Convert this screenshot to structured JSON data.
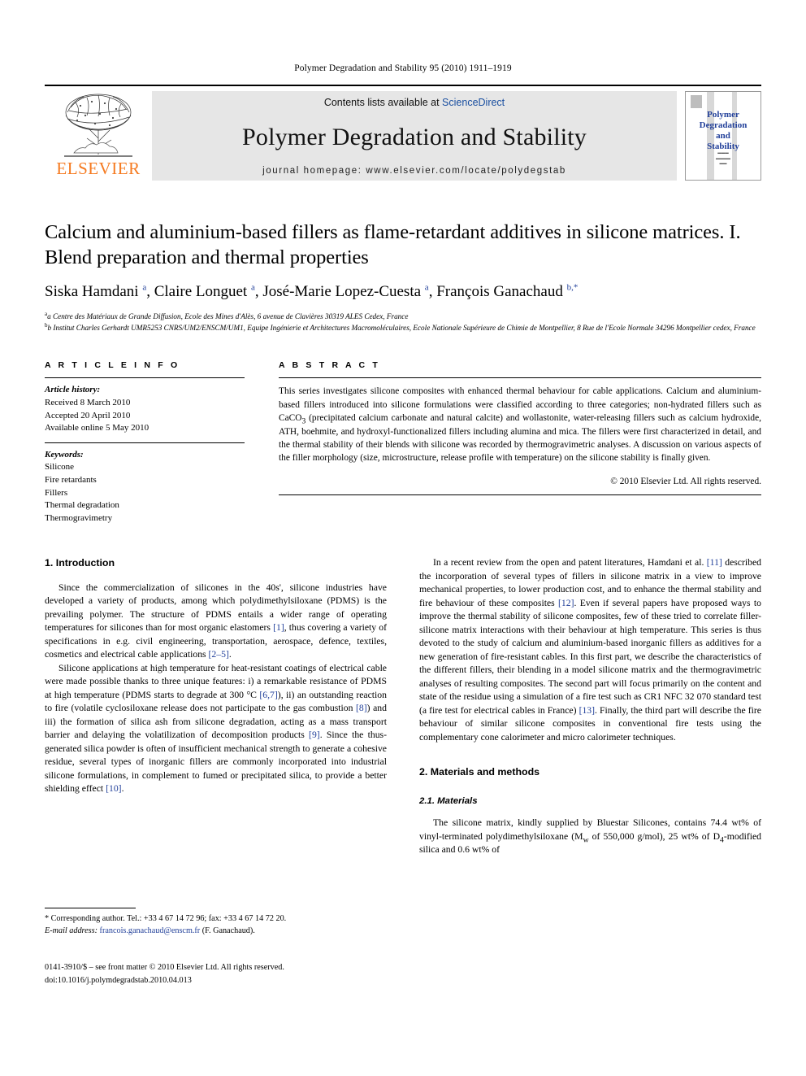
{
  "running_head": "Polymer Degradation and Stability 95 (2010) 1911–1919",
  "masthead": {
    "publisher_name": "ELSEVIER",
    "contents_prefix": "Contents lists available at ",
    "contents_link": "ScienceDirect",
    "journal_title": "Polymer Degradation and Stability",
    "homepage_line": "journal homepage: www.elsevier.com/locate/polydegstab",
    "cover_title_lines": [
      "Polymer",
      "Degradation",
      "and",
      "Stability"
    ]
  },
  "article": {
    "title": "Calcium and aluminium-based fillers as flame-retardant additives in silicone matrices. I. Blend preparation and thermal properties",
    "authors_html": "Siska Hamdani <sup>a</sup>, Claire Longuet <sup>a</sup>, José-Marie Lopez-Cuesta <sup>a</sup>, François Ganachaud <sup>b,*</sup>",
    "affiliations": [
      "a Centre des Matériaux de Grande Diffusion, Ecole des Mines d'Alès, 6 avenue de Clavières 30319 ALES Cedex, France",
      "b Institut Charles Gerhardt UMR5253 CNRS/UM2/ENSCM/UM1, Equipe Ingénierie et Architectures Macromoléculaires, Ecole Nationale Supérieure de Chimie de Montpellier, 8 Rue de l'Ecole Normale 34296 Montpellier cedex, France"
    ]
  },
  "article_info": {
    "heading": "A R T I C L E   I N F O",
    "history_label": "Article history:",
    "history": [
      "Received 8 March 2010",
      "Accepted 20 April 2010",
      "Available online 5 May 2010"
    ],
    "keywords_label": "Keywords:",
    "keywords": [
      "Silicone",
      "Fire retardants",
      "Fillers",
      "Thermal degradation",
      "Thermogravimetry"
    ]
  },
  "abstract": {
    "heading": "A B S T R A C T",
    "text": "This series investigates silicone composites with enhanced thermal behaviour for cable applications. Calcium and aluminium-based fillers introduced into silicone formulations were classified according to three categories; non-hydrated fillers such as CaCO3 (precipitated calcium carbonate and natural calcite) and wollastonite, water-releasing fillers such as calcium hydroxide, ATH, boehmite, and hydroxyl-functionalized fillers including alumina and mica. The fillers were first characterized in detail, and the thermal stability of their blends with silicone was recorded by thermogravimetric analyses. A discussion on various aspects of the filler morphology (size, microstructure, release profile with temperature) on the silicone stability is finally given.",
    "copyright": "© 2010 Elsevier Ltd. All rights reserved."
  },
  "sections": {
    "intro_heading": "1. Introduction",
    "intro_p1_a": "Since the commercialization of silicones in the 40s', silicone industries have developed a variety of products, among which polydimethylsiloxane (PDMS) is the prevailing polymer. The structure of PDMS entails a wider range of operating temperatures for silicones than for most organic elastomers ",
    "intro_p1_ref1": "[1]",
    "intro_p1_b": ", thus covering a variety of specifications in e.g. civil engineering, transportation, aerospace, defence, textiles, cosmetics and electrical cable applications ",
    "intro_p1_ref2": "[2–5]",
    "intro_p1_c": ".",
    "intro_p2_a": "Silicone applications at high temperature for heat-resistant coatings of electrical cable were made possible thanks to three unique features: i) a remarkable resistance of PDMS at high temperature (PDMS starts to degrade at 300 °C ",
    "intro_p2_ref1": "[6,7]",
    "intro_p2_b": "), ii) an outstanding reaction to fire (volatile cyclosiloxane release does not participate to the gas combustion ",
    "intro_p2_ref2": "[8]",
    "intro_p2_c": ") and iii) the formation of silica ash from silicone degradation, acting as a mass transport barrier and delaying the volatilization of decomposition products ",
    "intro_p2_ref3": "[9]",
    "intro_p2_d": ". Since the thus-generated silica powder is often of insufficient mechanical strength to generate a cohesive residue, several types of inorganic fillers are commonly incorporated into industrial silicone formulations, in complement to fumed or precipitated silica, to provide a better shielding effect ",
    "intro_p2_ref4": "[10]",
    "intro_p2_e": ".",
    "intro_p3_a": "In a recent review from the open and patent literatures, Hamdani et al. ",
    "intro_p3_ref1": "[11]",
    "intro_p3_b": " described the incorporation of several types of fillers in silicone matrix in a view to improve mechanical properties, to lower production cost, and to enhance the thermal stability and fire behaviour of these composites ",
    "intro_p3_ref2": "[12]",
    "intro_p3_c": ". Even if several papers have proposed ways to improve the thermal stability of silicone composites, few of these tried to correlate filler-silicone matrix interactions with their behaviour at high temperature. This series is thus devoted to the study of calcium and aluminium-based inorganic fillers as additives for a new generation of fire-resistant cables. In this first part, we describe the characteristics of the different fillers, their blending in a model silicone matrix and the thermogravimetric analyses of resulting composites. The second part will focus primarily on the content and state of the residue using a simulation of a fire test such as CR1 NFC 32 070 standard test (a fire test for electrical cables in France) ",
    "intro_p3_ref3": "[13]",
    "intro_p3_d": ". Finally, the third part will describe the fire behaviour of similar silicone composites in conventional fire tests using the complementary cone calorimeter and micro calorimeter techniques.",
    "materials_heading": "2. Materials and methods",
    "materials_sub_heading": "2.1. Materials",
    "materials_p1_a": "The silicone matrix, kindly supplied by Bluestar Silicones, contains 74.4 wt% of vinyl-terminated polydimethylsiloxane (M",
    "materials_p1_sub1": "w",
    "materials_p1_b": " of 550,000 g/mol), 25 wt% of D",
    "materials_p1_sub2": "4",
    "materials_p1_c": "-modified silica and 0.6 wt% of"
  },
  "footnote": {
    "corresponding": "* Corresponding author. Tel.: +33 4 67 14 72 96; fax: +33 4 67 14 72 20.",
    "email_label": "E-mail address:",
    "email": "francois.ganachaud@enscm.fr",
    "email_suffix": " (F. Ganachaud)."
  },
  "imprint": {
    "line1": "0141-3910/$ – see front matter © 2010 Elsevier Ltd. All rights reserved.",
    "line2": "doi:10.1016/j.polymdegradstab.2010.04.013"
  },
  "colors": {
    "link_blue": "#1a4fa0",
    "ref_blue": "#22409a",
    "elsevier_orange": "#F57A20",
    "band_gray": "#e6e6e6"
  }
}
